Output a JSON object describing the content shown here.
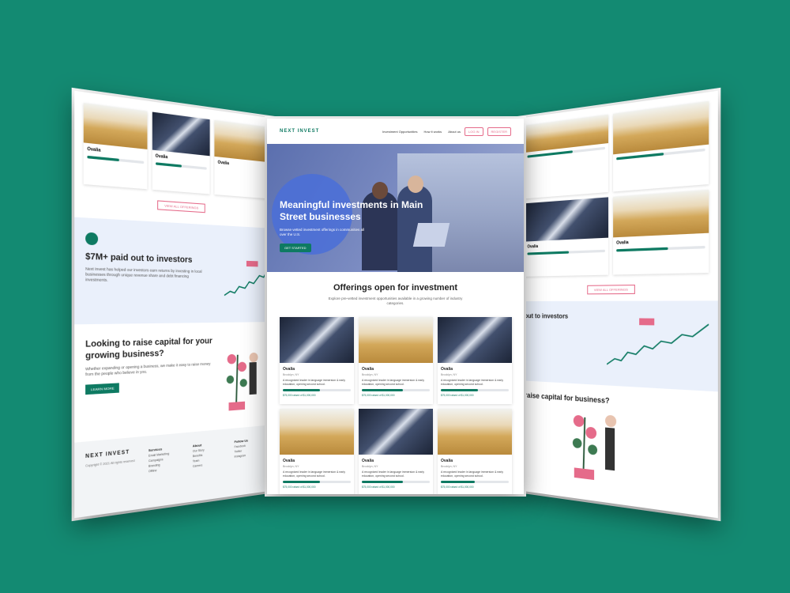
{
  "brand": {
    "accent": "#0e7a62",
    "pink": "#e56b8a",
    "background": "#138a72"
  },
  "nav": {
    "logo": "NEXT INVEST",
    "links": [
      "Investment Opportunities",
      "How it works",
      "About us"
    ],
    "login": "LOG IN",
    "register": "REGISTER"
  },
  "hero": {
    "title": "Meaningful investments in Main Street businesses",
    "subtitle": "Browse vetted investment offerings in communities all over the U.S.",
    "cta": "GET STARTED"
  },
  "offerings": {
    "title": "Offerings open for investment",
    "subtitle": "Explore pre-vetted investment opportunities available in a growing number of industry categories.",
    "cards": [
      {
        "name": "Ovalia",
        "location": "Brooklyn, NY",
        "desc": "A recognized leader in language immersion & early education, opening second school.",
        "raised": "$75,000 raised of $1,000,000",
        "progress": 0.55,
        "image": "building-icon"
      },
      {
        "name": "Ovalia",
        "location": "Brooklyn, NY",
        "desc": "A recognized leader in language immersion & early education, opening second school.",
        "raised": "$75,000 raised of $1,000,000",
        "progress": 0.6,
        "image": "wheat-icon"
      },
      {
        "name": "Ovalia",
        "location": "Brooklyn, NY",
        "desc": "A recognized leader in language immersion & early education, opening second school.",
        "raised": "$75,000 raised of $1,000,000",
        "progress": 0.55,
        "image": "building-icon"
      },
      {
        "name": "Ovalia",
        "location": "Brooklyn, NY",
        "desc": "A recognized leader in language immersion & early education, opening second school.",
        "raised": "$75,000 raised of $1,000,000",
        "progress": 0.55,
        "image": "wheat-icon"
      },
      {
        "name": "Ovalia",
        "location": "Brooklyn, NY",
        "desc": "A recognized leader in language immersion & early education, opening second school.",
        "raised": "$75,000 raised of $1,000,000",
        "progress": 0.6,
        "image": "building-icon"
      },
      {
        "name": "Ovalia",
        "location": "Brooklyn, NY",
        "desc": "A recognized leader in language immersion & early education, opening second school.",
        "raised": "$75,000 raised of $1,000,000",
        "progress": 0.5,
        "image": "wheat-icon"
      }
    ]
  },
  "left": {
    "card_names": [
      "Ovalia",
      "Ovalia",
      "Ovalia"
    ],
    "view_all": "VIEW ALL OFFERINGS",
    "stats_title": "$7M+ paid out to investors",
    "stats_text": "Next Invest has helped our investors earn returns by investing in local businesses through unique revenue share and debt financing investments.",
    "raise_title": "Looking to raise capital for your growing business?",
    "raise_text": "Whether expanding or opening a business, we make it easy to raise money from the people who believe in you.",
    "raise_cta": "LEARN MORE",
    "footer_logo": "NEXT INVEST",
    "copyright": "Copyright © 2021 All rights reserved",
    "footer_cols": [
      {
        "title": "Services",
        "items": [
          "Email Marketing",
          "Campaigns",
          "Branding",
          "Offline"
        ]
      },
      {
        "title": "About",
        "items": [
          "Our Story",
          "Benefits",
          "Team",
          "Careers"
        ]
      },
      {
        "title": "Follow Us",
        "items": [
          "Facebook",
          "Twitter",
          "Instagram"
        ]
      }
    ]
  },
  "right": {
    "card_names": [
      "Ovalia",
      "Ovalia"
    ],
    "view_all": "VIEW ALL OFFERINGS",
    "stats_title": "out to investors",
    "raise_title": "raise capital for business?"
  }
}
